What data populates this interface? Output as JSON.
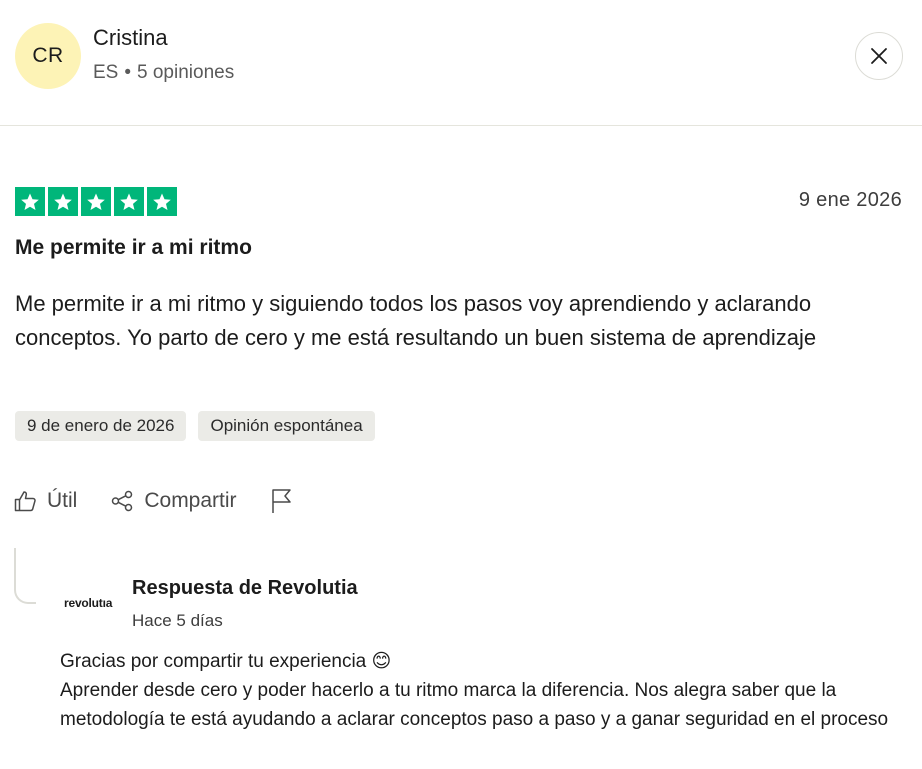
{
  "reviewer": {
    "initials": "CR",
    "name": "Cristina",
    "country": "ES",
    "separator": "•",
    "review_count": "5 opiniones"
  },
  "review": {
    "rating": 5,
    "date": "9 ene 2026",
    "title": "Me permite ir a mi ritmo",
    "body": "Me permite ir a mi ritmo y siguiendo todos los pasos voy aprendiendo y aclarando conceptos. Yo parto de cero y me está resultando un buen sistema de aprendizaje",
    "tags": [
      "9 de enero de 2026",
      "Opinión espontánea"
    ]
  },
  "actions": {
    "useful_label": "Útil",
    "share_label": "Compartir"
  },
  "reply": {
    "brand_logo_text": "revolutıa",
    "title": "Respuesta de Revolutia",
    "time": "Hace 5 días",
    "line1": "Gracias por compartir tu experiencia 😊",
    "line2": "Aprender desde cero y poder hacerlo a tu ritmo marca la diferencia. Nos alegra saber que la metodología te está ayudando a aclarar conceptos paso a paso y a ganar seguridad en el proceso"
  },
  "colors": {
    "star_green": "#00b67a",
    "avatar_bg": "#fdf3b6",
    "tag_bg": "#ebebe7"
  },
  "icons": [
    "close-icon",
    "star-icon",
    "thumbs-up-icon",
    "share-icon",
    "flag-icon"
  ]
}
